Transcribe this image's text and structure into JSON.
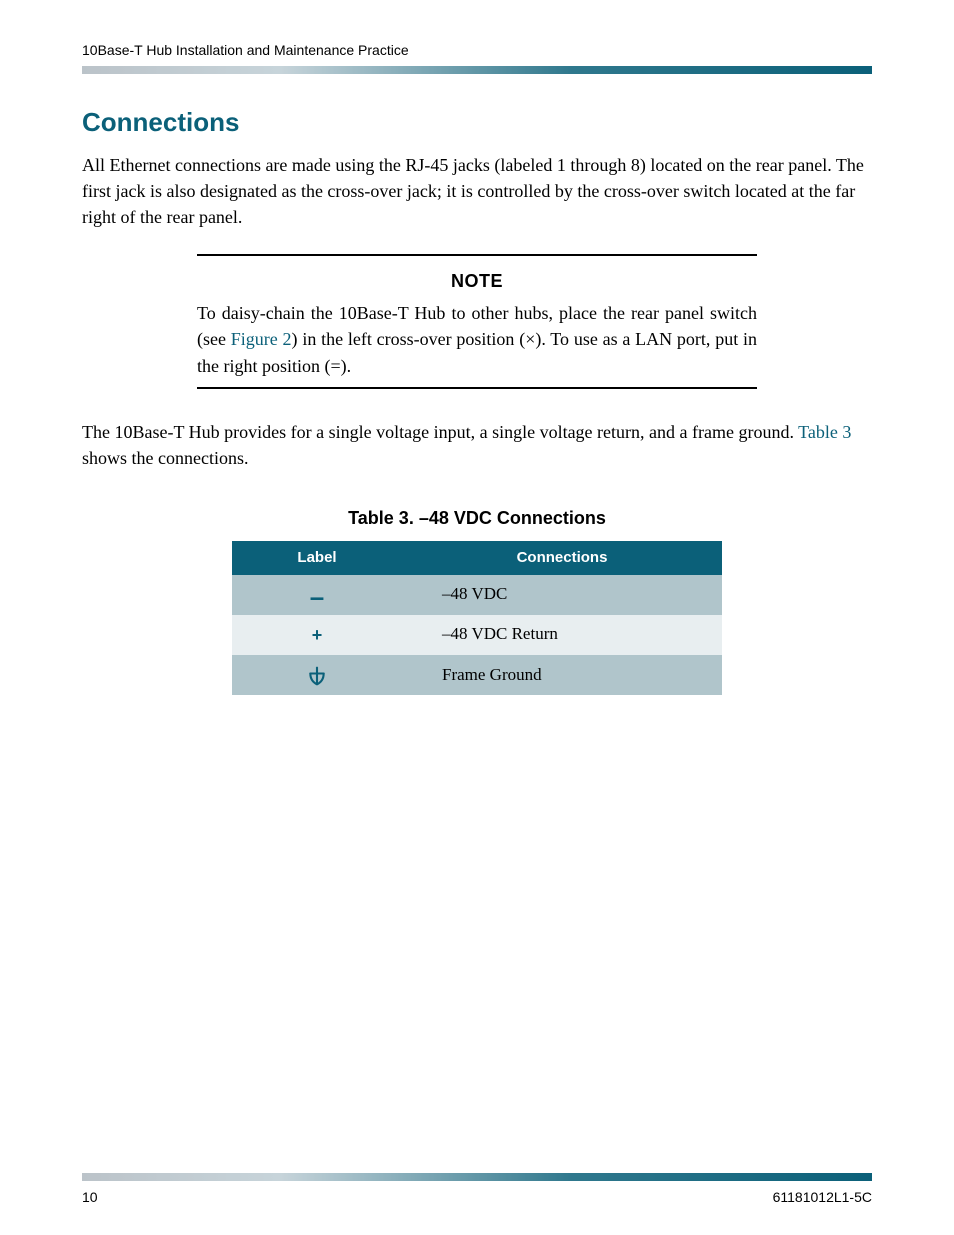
{
  "header": {
    "running_head": "10Base-T Hub Installation and Maintenance Practice"
  },
  "section": {
    "title": "Connections",
    "intro": "All Ethernet connections are made using the RJ-45 jacks (labeled 1 through 8) located on the rear panel. The first jack is also designated as the cross-over jack; it is controlled by the cross-over switch located at the far right of the rear panel."
  },
  "note": {
    "label": "NOTE",
    "before_link": "To daisy-chain the 10Base-T Hub to other hubs, place the rear panel switch (see ",
    "link_text": "Figure 2",
    "after_link": ") in the left cross-over position (×). To use as a LAN port, put in the right position (=)."
  },
  "after_note": {
    "before_link": "The 10Base-T Hub provides for a single voltage input, a single voltage return, and a frame ground. ",
    "link_text": "Table 3",
    "after_link": " shows the connections."
  },
  "table": {
    "caption": "Table 3.  –48 VDC Connections",
    "headers": {
      "label": "Label",
      "connections": "Connections"
    },
    "rows": [
      {
        "label": "–",
        "connection": "–48 VDC",
        "icon": "minus"
      },
      {
        "label": "+",
        "connection": "–48 VDC Return",
        "icon": "plus"
      },
      {
        "label": "⏚",
        "connection": "Frame Ground",
        "icon": "ground"
      }
    ]
  },
  "footer": {
    "page_number": "10",
    "doc_number": "61181012L1-5C"
  }
}
